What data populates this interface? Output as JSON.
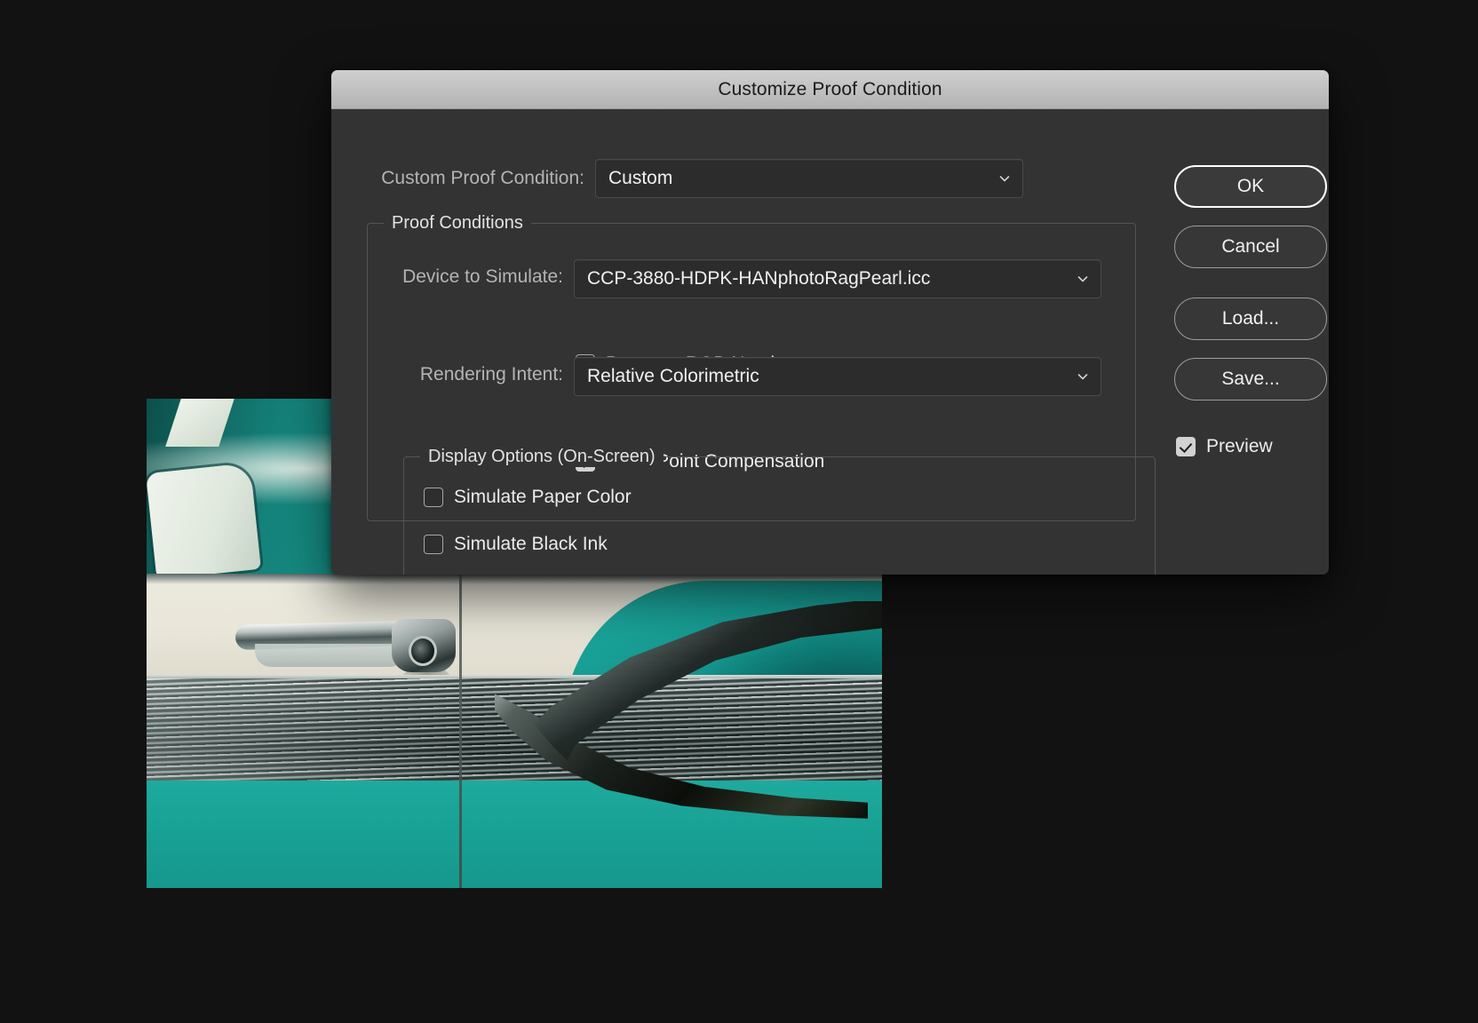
{
  "dialog": {
    "title": "Customize Proof Condition",
    "custom_proof_condition": {
      "label": "Custom Proof Condition:",
      "value": "Custom"
    },
    "proof_conditions": {
      "legend": "Proof Conditions",
      "device_to_simulate": {
        "label": "Device to Simulate:",
        "value": "CCP-3880-HDPK-HANphotoRagPearl.icc"
      },
      "preserve_rgb_numbers": {
        "label": "Preserve RGB Numbers",
        "checked": false
      },
      "rendering_intent": {
        "label": "Rendering Intent:",
        "value": "Relative Colorimetric"
      },
      "black_point_compensation": {
        "label": "Black Point Compensation",
        "checked": true
      }
    },
    "display_options": {
      "legend": "Display Options (On-Screen)",
      "simulate_paper_color": {
        "label": "Simulate Paper Color",
        "checked": false
      },
      "simulate_black_ink": {
        "label": "Simulate Black Ink",
        "checked": false
      }
    },
    "buttons": {
      "ok": "OK",
      "cancel": "Cancel",
      "load": "Load...",
      "save": "Save..."
    },
    "preview": {
      "label": "Preview",
      "checked": true
    }
  },
  "colors": {
    "desktop_background": "#121212",
    "dialog_background": "#333333",
    "titlebar": "#c2c2c2",
    "field_background": "#2c2c2c",
    "text_primary": "#ececec",
    "text_label": "#b4b4b4",
    "accent_focus_border": "#ffffff",
    "photo_teal": "#19a094"
  },
  "background_image": {
    "subject": "classic car side panel with chrome trim, teal body and cream door"
  }
}
